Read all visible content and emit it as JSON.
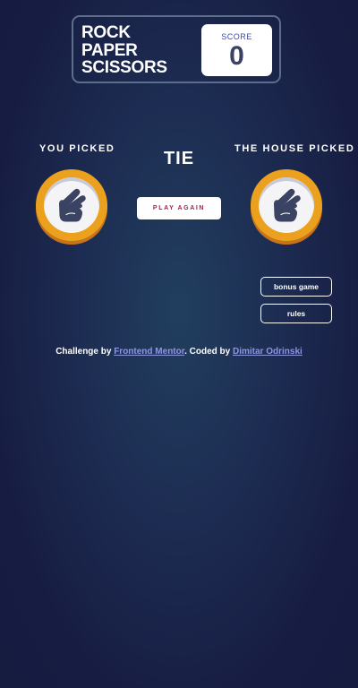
{
  "header": {
    "title_lines": [
      "ROCK",
      "PAPER",
      "SCISSORS"
    ],
    "score_label": "SCORE",
    "score_value": "0"
  },
  "game": {
    "you_label": "YOU PICKED",
    "house_label": "THE HOUSE PICKED",
    "you_pick": "scissors",
    "house_pick": "scissors",
    "result": "TIE",
    "play_again_label": "PLAY AGAIN",
    "token_icon": "scissors-hand-icon"
  },
  "side_buttons": {
    "bonus_label": "bonus game",
    "rules_label": "rules"
  },
  "attribution": {
    "prefix": "Challenge by ",
    "link1": "Frontend Mentor",
    "middle": ". Coded by ",
    "link2": "Dimitar Odrinski"
  },
  "colors": {
    "background_center": "#213f5f",
    "background_edge": "#161b40",
    "header_border": "#5d6e8c",
    "score_label": "#3b4bab",
    "score_value": "#3b4363",
    "scissors_ring": "#eba11d",
    "scissors_ring_shadow": "#c6731c",
    "play_again_text": "#a8214a",
    "link": "#8e96e0"
  }
}
